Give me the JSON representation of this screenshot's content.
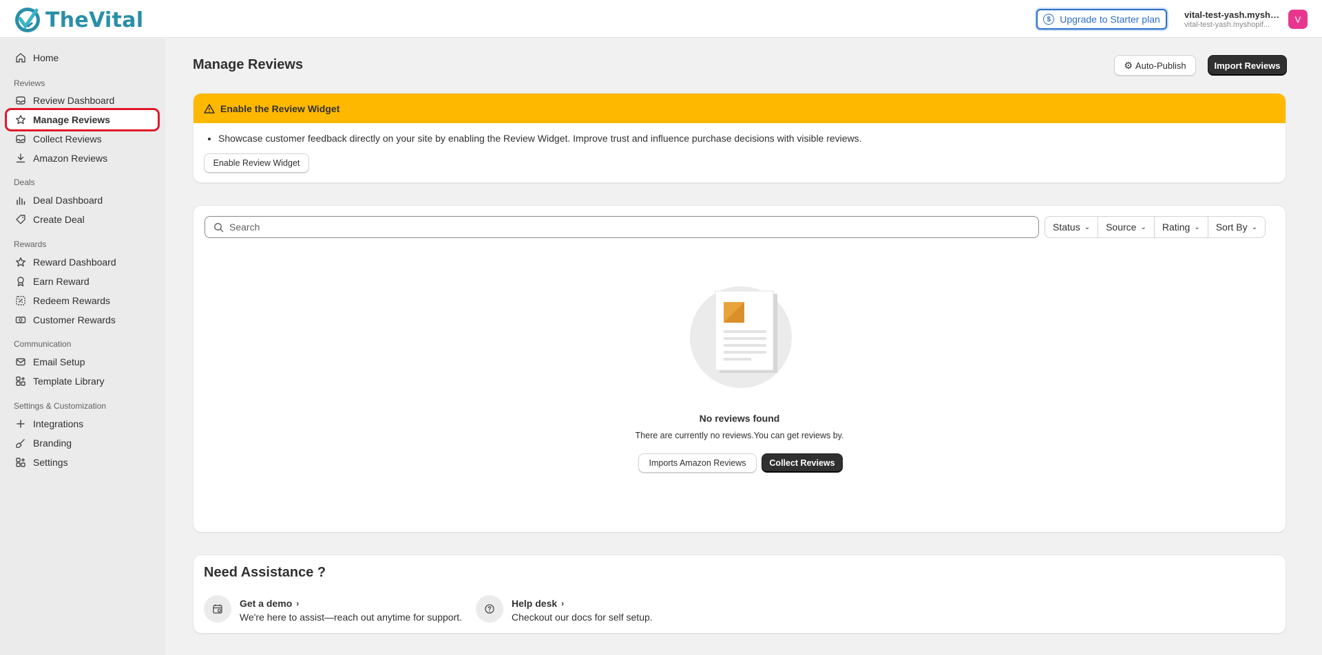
{
  "app": {
    "logo_text": "TheVital",
    "upgrade_label": "Upgrade to Starter plan",
    "store_name": "vital-test-yash.mysho...",
    "store_domain": "vital-test-yash.myshopif...",
    "avatar_initial": "V"
  },
  "sidebar": {
    "home": "Home",
    "section_reviews": "Reviews",
    "review_dashboard": "Review Dashboard",
    "manage_reviews": "Manage Reviews",
    "collect_reviews": "Collect Reviews",
    "amazon_reviews": "Amazon Reviews",
    "section_deals": "Deals",
    "deal_dashboard": "Deal Dashboard",
    "create_deal": "Create Deal",
    "section_rewards": "Rewards",
    "reward_dashboard": "Reward Dashboard",
    "earn_reward": "Earn Reward",
    "redeem_rewards": "Redeem Rewards",
    "customer_rewards": "Customer Rewards",
    "section_communication": "Communication",
    "email_setup": "Email Setup",
    "template_library": "Template Library",
    "section_settings": "Settings & Customization",
    "integrations": "Integrations",
    "branding": "Branding",
    "settings": "Settings"
  },
  "page": {
    "title": "Manage Reviews",
    "auto_publish_label": "Auto-Publish",
    "import_reviews_label": "Import Reviews"
  },
  "banner": {
    "title": "Enable the Review Widget",
    "bullet": "Showcase customer feedback directly on your site by enabling the Review Widget. Improve trust and influence purchase decisions with visible reviews.",
    "button_label": "Enable Review Widget"
  },
  "reviews": {
    "search_placeholder": "Search",
    "filters": [
      "Status",
      "Source",
      "Rating",
      "Sort By"
    ],
    "empty_title": "No reviews found",
    "empty_subtitle": "There are currently no reviews.You can get reviews by.",
    "imports_amazon_label": "Imports Amazon Reviews",
    "collect_label": "Collect Reviews"
  },
  "assistance": {
    "title": "Need Assistance ?",
    "demo_title": "Get a demo",
    "demo_desc": "We're here to assist—reach out anytime for support.",
    "help_title": "Help desk",
    "help_desc": "Checkout our docs for self setup."
  },
  "colors": {
    "accent_blue": "#2c6ecb",
    "banner_yellow": "#ffb800",
    "highlight_red": "#e0192b",
    "avatar_pink": "#e8368f"
  }
}
